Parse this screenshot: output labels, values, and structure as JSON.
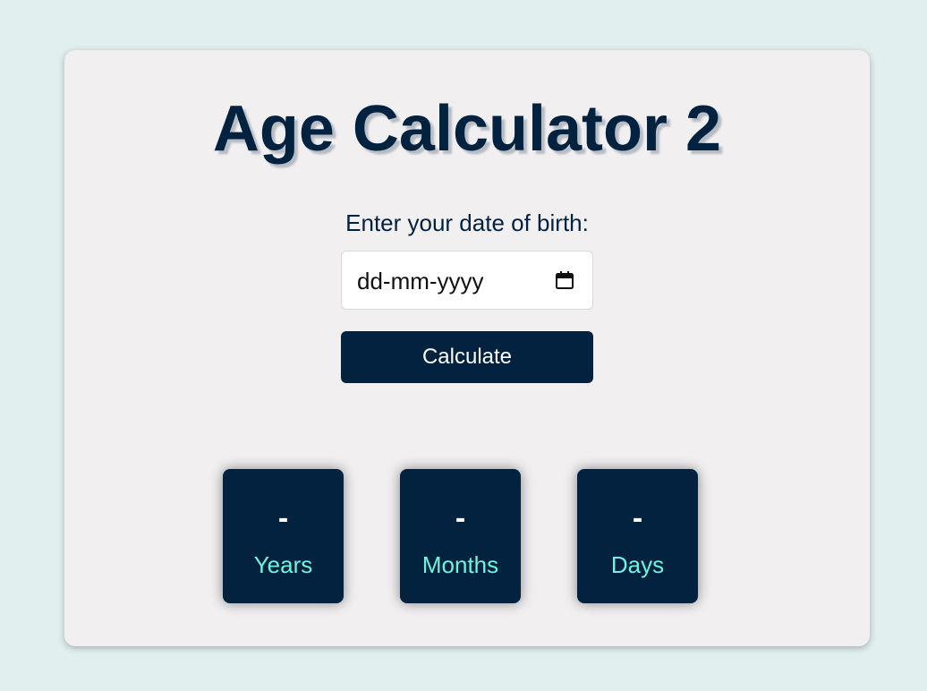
{
  "app": {
    "title": "Age Calculator 2"
  },
  "form": {
    "dob_label": "Enter your date of birth:",
    "date_placeholder": "dd-mm-yyyy",
    "calendar_icon": "calendar-icon",
    "calculate_label": "Calculate"
  },
  "results": {
    "years": {
      "value": "-",
      "label": "Years"
    },
    "months": {
      "value": "-",
      "label": "Months"
    },
    "days": {
      "value": "-",
      "label": "Days"
    }
  },
  "colors": {
    "page_background": "#e1f0ef",
    "card_background": "#f1eff0",
    "primary_navy": "#022240",
    "result_label_accent": "#6cf5dc"
  }
}
